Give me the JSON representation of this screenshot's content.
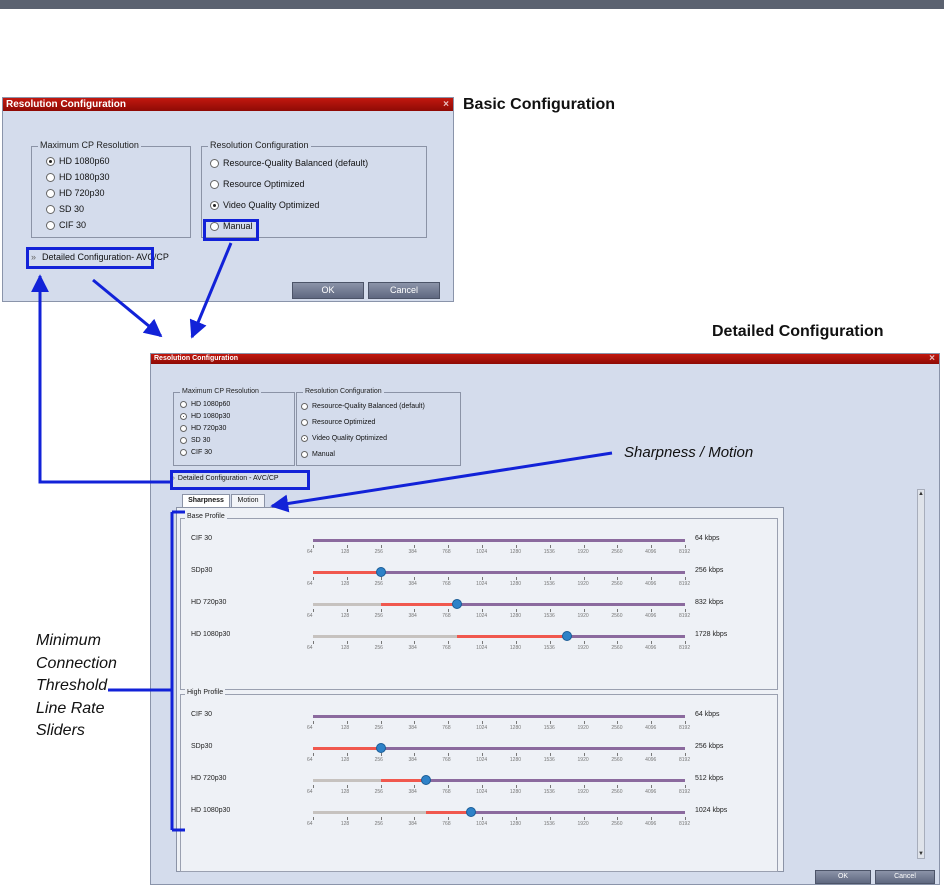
{
  "headings": {
    "basic": "Basic Configuration",
    "detailed": "Detailed Configuration"
  },
  "callouts": {
    "sharpness": "Sharpness / Motion",
    "threshold_lines": [
      "Minimum",
      "Connection",
      "Threshold",
      "Line Rate",
      "Sliders"
    ]
  },
  "basic_dialog": {
    "title": "Resolution Configuration",
    "close": "×",
    "max_cp_legend": "Maximum CP Resolution",
    "max_cp_options": [
      {
        "label": "HD 1080p60",
        "selected": true
      },
      {
        "label": "HD 1080p30",
        "selected": false
      },
      {
        "label": "HD 720p30",
        "selected": false
      },
      {
        "label": "SD 30",
        "selected": false
      },
      {
        "label": "CIF 30",
        "selected": false
      }
    ],
    "res_legend": "Resolution Configuration",
    "res_options": [
      {
        "label": "Resource-Quality Balanced (default)",
        "selected": false
      },
      {
        "label": "Resource Optimized",
        "selected": false
      },
      {
        "label": "Video Quality Optimized",
        "selected": true
      },
      {
        "label": "Manual",
        "selected": false
      }
    ],
    "detailed_link": "Detailed Configuration",
    "detailed_suffix": " - AVC/CP",
    "ok": "OK",
    "cancel": "Cancel"
  },
  "detailed_dialog": {
    "title": "Resolution Configuration",
    "close": "×",
    "max_cp_legend": "Maximum CP Resolution",
    "max_cp_options": [
      {
        "label": "HD 1080p60",
        "selected": false
      },
      {
        "label": "HD 1080p30",
        "selected": true
      },
      {
        "label": "HD 720p30",
        "selected": false
      },
      {
        "label": "SD 30",
        "selected": false
      },
      {
        "label": "CIF 30",
        "selected": false
      }
    ],
    "res_legend": "Resolution Configuration",
    "res_options": [
      {
        "label": "Resource-Quality Balanced (default)",
        "selected": false
      },
      {
        "label": "Resource Optimized",
        "selected": false
      },
      {
        "label": "Video Quality Optimized",
        "selected": true
      },
      {
        "label": "Manual",
        "selected": false
      }
    ],
    "detailed_link": "Detailed Configuration - AVC/CP",
    "tabs": [
      "Sharpness",
      "Motion"
    ],
    "active_tab": "Sharpness",
    "ok": "OK",
    "cancel": "Cancel",
    "scale_labels": [
      "64",
      "128",
      "256",
      "384",
      "768",
      "1024",
      "1280",
      "1536",
      "1920",
      "2560",
      "4096",
      "8192"
    ],
    "profiles": [
      {
        "name": "Base Profile",
        "sliders": [
          {
            "label": "CIF 30",
            "value_kbps": 64,
            "value_text": "64 kbps",
            "scale_index": 0
          },
          {
            "label": "SDp30",
            "value_kbps": 256,
            "value_text": "256 kbps",
            "scale_index": 2
          },
          {
            "label": "HD 720p30",
            "value_kbps": 832,
            "value_text": "832 kbps",
            "scale_index": 4.25
          },
          {
            "label": "HD 1080p30",
            "value_kbps": 1728,
            "value_text": "1728 kbps",
            "scale_index": 7.5
          }
        ]
      },
      {
        "name": "High Profile",
        "sliders": [
          {
            "label": "CIF 30",
            "value_kbps": 64,
            "value_text": "64 kbps",
            "scale_index": 0
          },
          {
            "label": "SDp30",
            "value_kbps": 256,
            "value_text": "256 kbps",
            "scale_index": 2
          },
          {
            "label": "HD 720p30",
            "value_kbps": 512,
            "value_text": "512 kbps",
            "scale_index": 3.33
          },
          {
            "label": "HD 1080p30",
            "value_kbps": 1024,
            "value_text": "1024 kbps",
            "scale_index": 4.67
          }
        ]
      }
    ]
  },
  "colors": {
    "title_red": "#b3140b",
    "highlight_blue": "#1222d8",
    "slider_red": "#f0584e",
    "slider_purple": "#8b6a9e",
    "slider_grey": "#c6c2bf",
    "knob_blue": "#2e82c8"
  }
}
